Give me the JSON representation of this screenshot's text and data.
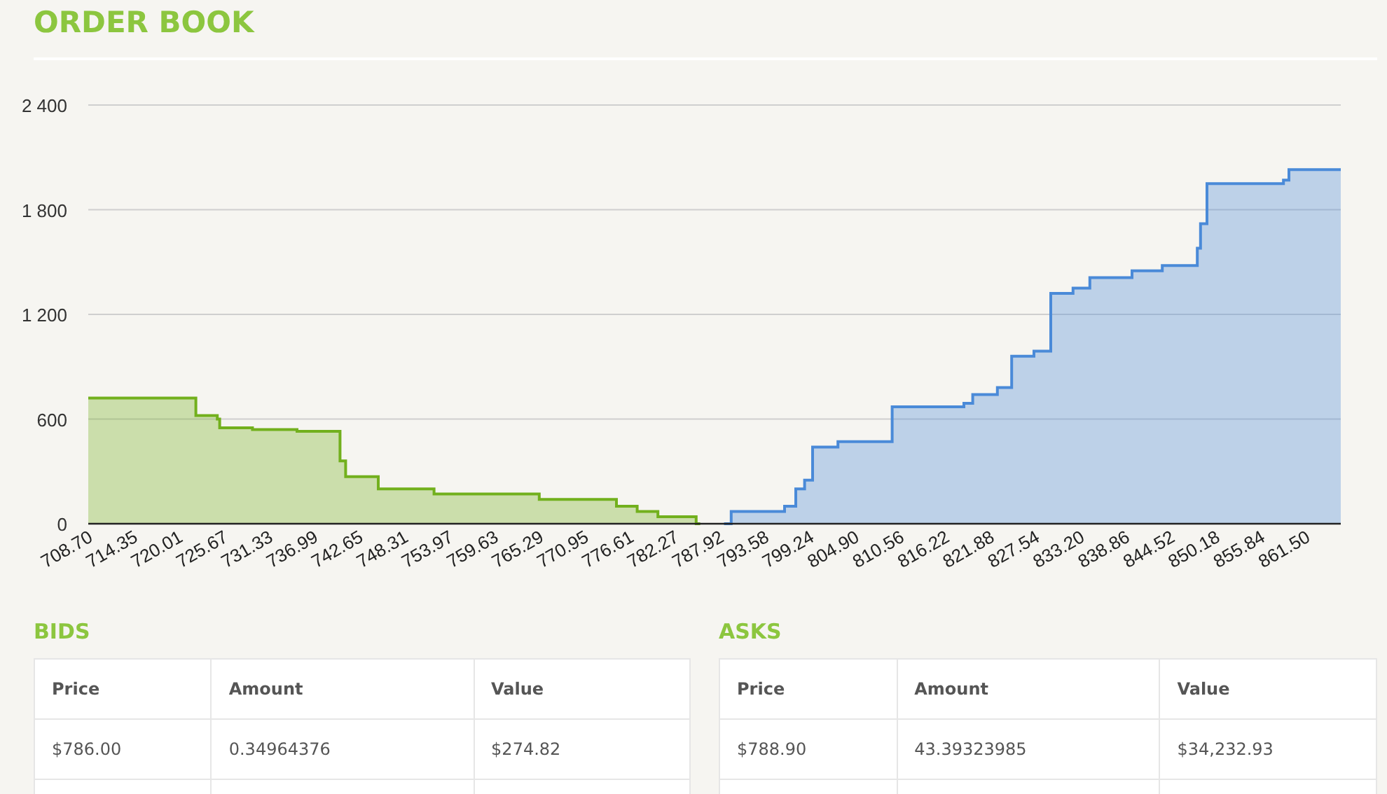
{
  "title": "ORDER BOOK",
  "chart_data": {
    "type": "area",
    "grid": true,
    "xlim": [
      708.7,
      865.9
    ],
    "ylim": [
      0,
      2400
    ],
    "yticks": [
      0,
      600,
      {
        "value": 1200,
        "label": "1 200"
      },
      {
        "value": 1800,
        "label": "1 800"
      },
      {
        "value": 2400,
        "label": "2 400"
      }
    ],
    "xticks": [
      {
        "value": 708.7,
        "label": "708.70"
      },
      {
        "value": 714.35,
        "label": "714.35"
      },
      {
        "value": 720.01,
        "label": "720.01"
      },
      {
        "value": 725.67,
        "label": "725.67"
      },
      {
        "value": 731.33,
        "label": "731.33"
      },
      {
        "value": 736.99,
        "label": "736.99"
      },
      {
        "value": 742.65,
        "label": "742.65"
      },
      {
        "value": 748.31,
        "label": "748.31"
      },
      {
        "value": 753.97,
        "label": "753.97"
      },
      {
        "value": 759.63,
        "label": "759.63"
      },
      {
        "value": 765.29,
        "label": "765.29"
      },
      {
        "value": 770.95,
        "label": "770.95"
      },
      {
        "value": 776.61,
        "label": "776.61"
      },
      {
        "value": 782.27,
        "label": "782.27"
      },
      {
        "value": 787.92,
        "label": "787.92"
      },
      {
        "value": 793.58,
        "label": "793.58"
      },
      {
        "value": 799.24,
        "label": "799.24"
      },
      {
        "value": 804.9,
        "label": "804.90"
      },
      {
        "value": 810.56,
        "label": "810.56"
      },
      {
        "value": 816.22,
        "label": "816.22"
      },
      {
        "value": 821.88,
        "label": "821.88"
      },
      {
        "value": 827.54,
        "label": "827.54"
      },
      {
        "value": 833.2,
        "label": "833.20"
      },
      {
        "value": 838.86,
        "label": "838.86"
      },
      {
        "value": 844.52,
        "label": "844.52"
      },
      {
        "value": 850.18,
        "label": "850.18"
      },
      {
        "value": 855.84,
        "label": "855.84"
      },
      {
        "value": 861.5,
        "label": "861.50"
      }
    ],
    "x": [
      708.7,
      722.2,
      722.2,
      724.9,
      724.9,
      725.2,
      725.2,
      729.3,
      729.3,
      734.9,
      734.9,
      740.3,
      740.3,
      741.0,
      741.0,
      745.1,
      745.1,
      752.1,
      752.1,
      765.3,
      765.3,
      775.0,
      775.0,
      777.6,
      777.6,
      780.2,
      780.2,
      785.0,
      785.0,
      785.5,
      788.5,
      789.4,
      789.4,
      796.1,
      796.1,
      797.5,
      797.5,
      798.6,
      798.6,
      799.6,
      799.6,
      802.8,
      802.8,
      809.6,
      809.6,
      818.6,
      818.6,
      819.7,
      819.7,
      822.8,
      822.8,
      824.6,
      824.6,
      827.4,
      827.4,
      829.5,
      829.5,
      832.3,
      832.3,
      834.4,
      834.4,
      839.7,
      839.7,
      843.5,
      843.5,
      847.9,
      847.9,
      848.3,
      848.3,
      849.1,
      849.1,
      858.7,
      858.7,
      859.4,
      859.4,
      865.9
    ],
    "series": [
      {
        "color": "#72b01d",
        "values": [
          720,
          720,
          620,
          620,
          600,
          600,
          550,
          550,
          540,
          540,
          530,
          530,
          360,
          360,
          270,
          270,
          200,
          200,
          170,
          170,
          140,
          140,
          100,
          100,
          70,
          70,
          40,
          40,
          0,
          0,
          null,
          null,
          null,
          null,
          null,
          null,
          null,
          null,
          null,
          null,
          null,
          null,
          null,
          null,
          null,
          null,
          null,
          null,
          null,
          null,
          null,
          null,
          null,
          null,
          null,
          null,
          null,
          null,
          null,
          null,
          null,
          null,
          null,
          null,
          null,
          null,
          null,
          null,
          null,
          null,
          null,
          null,
          null,
          null,
          null,
          null
        ]
      },
      {
        "color": "#4a8ad8",
        "values": [
          null,
          null,
          null,
          null,
          null,
          null,
          null,
          null,
          null,
          null,
          null,
          null,
          null,
          null,
          null,
          null,
          null,
          null,
          null,
          null,
          null,
          null,
          null,
          null,
          null,
          null,
          null,
          null,
          null,
          null,
          0,
          0,
          70,
          70,
          100,
          100,
          200,
          200,
          250,
          250,
          440,
          440,
          470,
          470,
          670,
          670,
          690,
          690,
          740,
          740,
          780,
          780,
          960,
          960,
          990,
          990,
          1320,
          1320,
          1350,
          1350,
          1410,
          1410,
          1450,
          1450,
          1480,
          1480,
          1580,
          1580,
          1720,
          1720,
          1950,
          1950,
          1970,
          1970,
          2030,
          2030
        ]
      }
    ]
  },
  "tables": [
    {
      "title": "BIDS",
      "columns": [
        "Price",
        "Amount",
        "Value"
      ],
      "rows": [
        [
          "$786.00",
          "0.34964376",
          "$274.82"
        ]
      ]
    },
    {
      "title": "ASKS",
      "columns": [
        "Price",
        "Amount",
        "Value"
      ],
      "rows": [
        [
          "$788.90",
          "43.39323985",
          "$34,232.93"
        ]
      ]
    }
  ]
}
